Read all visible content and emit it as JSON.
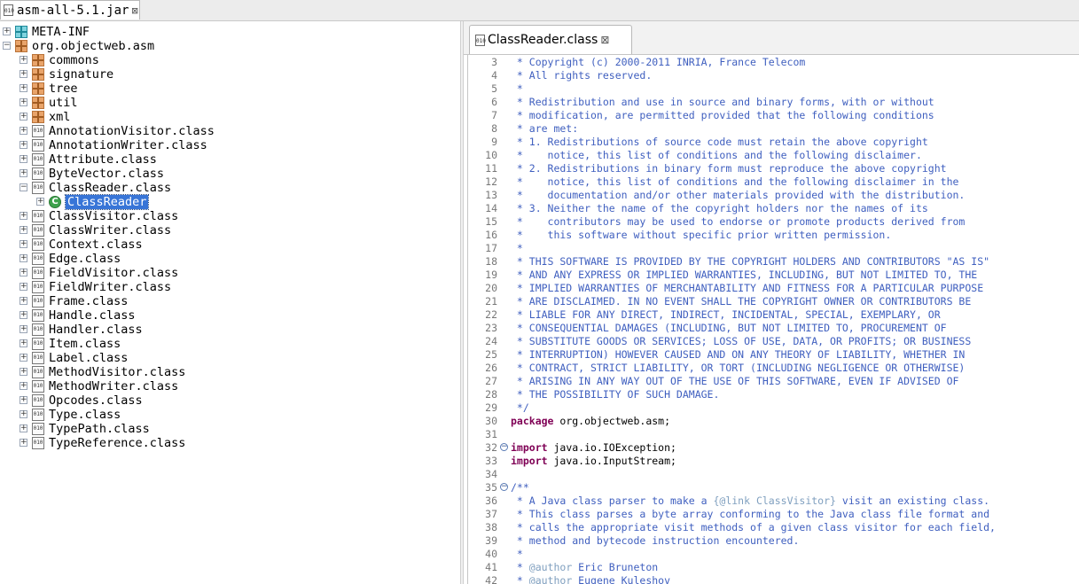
{
  "top_tab": {
    "label": "asm-all-5.1.jar",
    "icon": "jar-icon"
  },
  "tree": {
    "rows": [
      {
        "label": "META-INF",
        "level": 0,
        "icon": "folder-package-icon",
        "expanded": false,
        "selected": false
      },
      {
        "label": "org.objectweb.asm",
        "level": 0,
        "icon": "package-icon",
        "expanded": true,
        "selected": false
      },
      {
        "label": "commons",
        "level": 1,
        "icon": "package-icon",
        "expanded": false,
        "selected": false
      },
      {
        "label": "signature",
        "level": 1,
        "icon": "package-icon",
        "expanded": false,
        "selected": false
      },
      {
        "label": "tree",
        "level": 1,
        "icon": "package-icon",
        "expanded": false,
        "selected": false
      },
      {
        "label": "util",
        "level": 1,
        "icon": "package-icon",
        "expanded": false,
        "selected": false
      },
      {
        "label": "xml",
        "level": 1,
        "icon": "package-icon",
        "expanded": false,
        "selected": false
      },
      {
        "label": "AnnotationVisitor.class",
        "level": 1,
        "icon": "class-file-icon",
        "expanded": false,
        "selected": false
      },
      {
        "label": "AnnotationWriter.class",
        "level": 1,
        "icon": "class-file-icon",
        "expanded": false,
        "selected": false
      },
      {
        "label": "Attribute.class",
        "level": 1,
        "icon": "class-file-icon",
        "expanded": false,
        "selected": false
      },
      {
        "label": "ByteVector.class",
        "level": 1,
        "icon": "class-file-icon",
        "expanded": false,
        "selected": false
      },
      {
        "label": "ClassReader.class",
        "level": 1,
        "icon": "class-file-icon",
        "expanded": true,
        "selected": false
      },
      {
        "label": "ClassReader",
        "level": 2,
        "icon": "class-icon",
        "expanded": false,
        "selected": true
      },
      {
        "label": "ClassVisitor.class",
        "level": 1,
        "icon": "class-file-icon",
        "expanded": false,
        "selected": false
      },
      {
        "label": "ClassWriter.class",
        "level": 1,
        "icon": "class-file-icon",
        "expanded": false,
        "selected": false
      },
      {
        "label": "Context.class",
        "level": 1,
        "icon": "class-file-icon",
        "expanded": false,
        "selected": false
      },
      {
        "label": "Edge.class",
        "level": 1,
        "icon": "class-file-icon",
        "expanded": false,
        "selected": false
      },
      {
        "label": "FieldVisitor.class",
        "level": 1,
        "icon": "class-file-icon",
        "expanded": false,
        "selected": false
      },
      {
        "label": "FieldWriter.class",
        "level": 1,
        "icon": "class-file-icon",
        "expanded": false,
        "selected": false
      },
      {
        "label": "Frame.class",
        "level": 1,
        "icon": "class-file-icon",
        "expanded": false,
        "selected": false
      },
      {
        "label": "Handle.class",
        "level": 1,
        "icon": "class-file-icon",
        "expanded": false,
        "selected": false
      },
      {
        "label": "Handler.class",
        "level": 1,
        "icon": "class-file-icon",
        "expanded": false,
        "selected": false
      },
      {
        "label": "Item.class",
        "level": 1,
        "icon": "class-file-icon",
        "expanded": false,
        "selected": false
      },
      {
        "label": "Label.class",
        "level": 1,
        "icon": "class-file-icon",
        "expanded": false,
        "selected": false
      },
      {
        "label": "MethodVisitor.class",
        "level": 1,
        "icon": "class-file-icon",
        "expanded": false,
        "selected": false
      },
      {
        "label": "MethodWriter.class",
        "level": 1,
        "icon": "class-file-icon",
        "expanded": false,
        "selected": false
      },
      {
        "label": "Opcodes.class",
        "level": 1,
        "icon": "class-file-icon",
        "expanded": false,
        "selected": false
      },
      {
        "label": "Type.class",
        "level": 1,
        "icon": "class-file-icon",
        "expanded": false,
        "selected": false
      },
      {
        "label": "TypePath.class",
        "level": 1,
        "icon": "class-file-icon",
        "expanded": false,
        "selected": false
      },
      {
        "label": "TypeReference.class",
        "level": 1,
        "icon": "class-file-icon",
        "expanded": false,
        "selected": false
      }
    ]
  },
  "editor": {
    "tab_label": "ClassReader.class",
    "tab_icon": "class-file-icon",
    "lines": [
      {
        "n": "3",
        "fold": "",
        "seg": [
          [
            "cmt",
            " * Copyright (c) 2000-2011 INRIA, France Telecom"
          ]
        ]
      },
      {
        "n": "4",
        "fold": "",
        "seg": [
          [
            "cmt",
            " * All rights reserved."
          ]
        ]
      },
      {
        "n": "5",
        "fold": "",
        "seg": [
          [
            "cmt",
            " *"
          ]
        ]
      },
      {
        "n": "6",
        "fold": "",
        "seg": [
          [
            "cmt",
            " * Redistribution and use in source and binary forms, with or without"
          ]
        ]
      },
      {
        "n": "7",
        "fold": "",
        "seg": [
          [
            "cmt",
            " * modification, are permitted provided that the following conditions"
          ]
        ]
      },
      {
        "n": "8",
        "fold": "",
        "seg": [
          [
            "cmt",
            " * are met:"
          ]
        ]
      },
      {
        "n": "9",
        "fold": "",
        "seg": [
          [
            "cmt",
            " * 1. Redistributions of source code must retain the above copyright"
          ]
        ]
      },
      {
        "n": "10",
        "fold": "",
        "seg": [
          [
            "cmt",
            " *    notice, this list of conditions and the following disclaimer."
          ]
        ]
      },
      {
        "n": "11",
        "fold": "",
        "seg": [
          [
            "cmt",
            " * 2. Redistributions in binary form must reproduce the above copyright"
          ]
        ]
      },
      {
        "n": "12",
        "fold": "",
        "seg": [
          [
            "cmt",
            " *    notice, this list of conditions and the following disclaimer in the"
          ]
        ]
      },
      {
        "n": "13",
        "fold": "",
        "seg": [
          [
            "cmt",
            " *    documentation and/or other materials provided with the distribution."
          ]
        ]
      },
      {
        "n": "14",
        "fold": "",
        "seg": [
          [
            "cmt",
            " * 3. Neither the name of the copyright holders nor the names of its"
          ]
        ]
      },
      {
        "n": "15",
        "fold": "",
        "seg": [
          [
            "cmt",
            " *    contributors may be used to endorse or promote products derived from"
          ]
        ]
      },
      {
        "n": "16",
        "fold": "",
        "seg": [
          [
            "cmt",
            " *    this software without specific prior written permission."
          ]
        ]
      },
      {
        "n": "17",
        "fold": "",
        "seg": [
          [
            "cmt",
            " *"
          ]
        ]
      },
      {
        "n": "18",
        "fold": "",
        "seg": [
          [
            "cmt",
            " * THIS SOFTWARE IS PROVIDED BY THE COPYRIGHT HOLDERS AND CONTRIBUTORS \"AS IS\""
          ]
        ]
      },
      {
        "n": "19",
        "fold": "",
        "seg": [
          [
            "cmt",
            " * AND ANY EXPRESS OR IMPLIED WARRANTIES, INCLUDING, BUT NOT LIMITED TO, THE"
          ]
        ]
      },
      {
        "n": "20",
        "fold": "",
        "seg": [
          [
            "cmt",
            " * IMPLIED WARRANTIES OF MERCHANTABILITY AND FITNESS FOR A PARTICULAR PURPOSE"
          ]
        ]
      },
      {
        "n": "21",
        "fold": "",
        "seg": [
          [
            "cmt",
            " * ARE DISCLAIMED. IN NO EVENT SHALL THE COPYRIGHT OWNER OR CONTRIBUTORS BE"
          ]
        ]
      },
      {
        "n": "22",
        "fold": "",
        "seg": [
          [
            "cmt",
            " * LIABLE FOR ANY DIRECT, INDIRECT, INCIDENTAL, SPECIAL, EXEMPLARY, OR"
          ]
        ]
      },
      {
        "n": "23",
        "fold": "",
        "seg": [
          [
            "cmt",
            " * CONSEQUENTIAL DAMAGES (INCLUDING, BUT NOT LIMITED TO, PROCUREMENT OF"
          ]
        ]
      },
      {
        "n": "24",
        "fold": "",
        "seg": [
          [
            "cmt",
            " * SUBSTITUTE GOODS OR SERVICES; LOSS OF USE, DATA, OR PROFITS; OR BUSINESS"
          ]
        ]
      },
      {
        "n": "25",
        "fold": "",
        "seg": [
          [
            "cmt",
            " * INTERRUPTION) HOWEVER CAUSED AND ON ANY THEORY OF LIABILITY, WHETHER IN"
          ]
        ]
      },
      {
        "n": "26",
        "fold": "",
        "seg": [
          [
            "cmt",
            " * CONTRACT, STRICT LIABILITY, OR TORT (INCLUDING NEGLIGENCE OR OTHERWISE)"
          ]
        ]
      },
      {
        "n": "27",
        "fold": "",
        "seg": [
          [
            "cmt",
            " * ARISING IN ANY WAY OUT OF THE USE OF THIS SOFTWARE, EVEN IF ADVISED OF"
          ]
        ]
      },
      {
        "n": "28",
        "fold": "",
        "seg": [
          [
            "cmt",
            " * THE POSSIBILITY OF SUCH DAMAGE."
          ]
        ]
      },
      {
        "n": "29",
        "fold": "",
        "seg": [
          [
            "cmt",
            " */"
          ]
        ]
      },
      {
        "n": "30",
        "fold": "",
        "seg": [
          [
            "kw",
            "package"
          ],
          [
            "plain",
            " org.objectweb.asm;"
          ]
        ]
      },
      {
        "n": "31",
        "fold": "",
        "seg": [
          [
            "plain",
            ""
          ]
        ]
      },
      {
        "n": "32",
        "fold": "−",
        "seg": [
          [
            "kw",
            "import"
          ],
          [
            "plain",
            " java.io.IOException;"
          ]
        ]
      },
      {
        "n": "33",
        "fold": "",
        "seg": [
          [
            "kw",
            "import"
          ],
          [
            "plain",
            " java.io.InputStream;"
          ]
        ]
      },
      {
        "n": "34",
        "fold": "",
        "seg": [
          [
            "plain",
            ""
          ]
        ]
      },
      {
        "n": "35",
        "fold": "−",
        "seg": [
          [
            "cmt",
            "/**"
          ]
        ]
      },
      {
        "n": "36",
        "fold": "",
        "seg": [
          [
            "cmt",
            " * A Java class parser to make a "
          ],
          [
            "tag",
            "{@link ClassVisitor}"
          ],
          [
            "cmt",
            " visit an existing class."
          ]
        ]
      },
      {
        "n": "37",
        "fold": "",
        "seg": [
          [
            "cmt",
            " * This class parses a byte array conforming to the Java class file format and"
          ]
        ]
      },
      {
        "n": "38",
        "fold": "",
        "seg": [
          [
            "cmt",
            " * calls the appropriate visit methods of a given class visitor for each field,"
          ]
        ]
      },
      {
        "n": "39",
        "fold": "",
        "seg": [
          [
            "cmt",
            " * method and bytecode instruction encountered."
          ]
        ]
      },
      {
        "n": "40",
        "fold": "",
        "seg": [
          [
            "cmt",
            " *"
          ]
        ]
      },
      {
        "n": "41",
        "fold": "",
        "seg": [
          [
            "cmt",
            " * "
          ],
          [
            "tag",
            "@author"
          ],
          [
            "cmt",
            " Eric Bruneton"
          ]
        ]
      },
      {
        "n": "42",
        "fold": "",
        "seg": [
          [
            "cmt",
            " * "
          ],
          [
            "tag",
            "@author"
          ],
          [
            "cmt",
            " Eugene Kuleshov"
          ]
        ]
      }
    ]
  }
}
